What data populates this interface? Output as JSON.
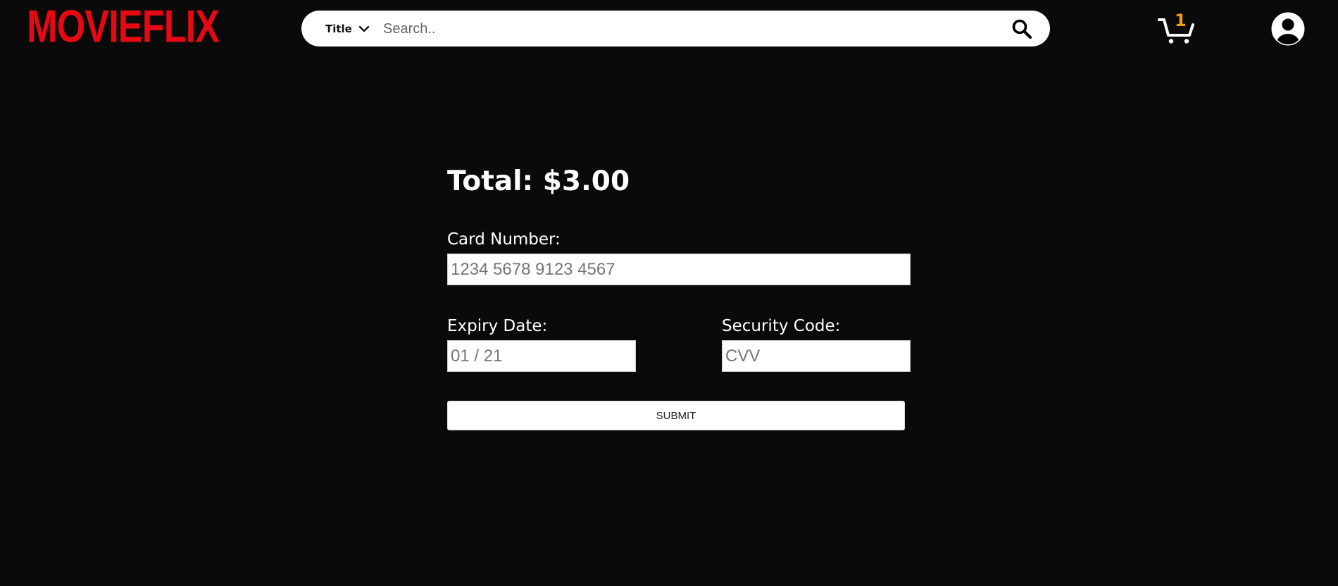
{
  "brand": {
    "logo_text": "MOVIEFLIX",
    "logo_color": "#e50914"
  },
  "header": {
    "search": {
      "filter_label": "Title",
      "placeholder": "Search..",
      "value": "",
      "icon": "search-icon"
    },
    "cart": {
      "icon": "cart-icon",
      "count": "1",
      "count_color": "#f5a000"
    },
    "account": {
      "icon": "user-avatar-icon"
    }
  },
  "checkout": {
    "total_label": "Total: $3.00",
    "card_number": {
      "label": "Card Number:",
      "placeholder": "1234 5678 9123 4567",
      "value": ""
    },
    "expiry": {
      "label": "Expiry Date:",
      "placeholder": "01 / 21",
      "value": ""
    },
    "security_code": {
      "label": "Security Code:",
      "placeholder": "CVV",
      "value": ""
    },
    "submit_label": "SUBMIT"
  },
  "colors": {
    "background": "#0a0a0a",
    "text": "#ffffff"
  }
}
